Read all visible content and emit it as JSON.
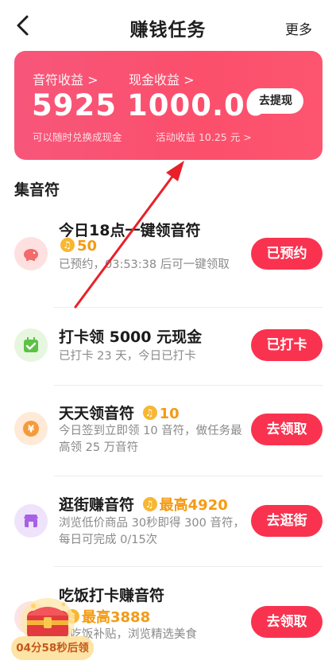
{
  "header": {
    "title": "赚钱任务",
    "more_label": "更多"
  },
  "earnings": {
    "notes_label": "音符收益 >",
    "notes_value": "5925",
    "notes_hint": "可以随时兑换成现金",
    "cash_label": "现金收益 >",
    "cash_value": "1000.00",
    "activity_hint": "活动收益 10.25 元 >",
    "withdraw_label": "去提现",
    "card_color": "#fb4f6c"
  },
  "section": {
    "title": "集音符"
  },
  "tasks": [
    {
      "icon": "piggy-bank-icon",
      "title": "今日18点一键领音符",
      "reward": "50",
      "desc": "已预约，03:53:38 后可一键领取",
      "button": "已预约"
    },
    {
      "icon": "calendar-check-icon",
      "title": "打卡领 5000 元现金",
      "reward": "",
      "desc": "已打卡 23 天，今日已打卡",
      "button": "已打卡"
    },
    {
      "icon": "yuan-coin-icon",
      "title": "天天领音符",
      "reward": "10",
      "desc": "今日签到立即领 10 音符，做任务最高领 25 万音符",
      "button": "去领取"
    },
    {
      "icon": "shop-icon",
      "title": "逛街赚音符",
      "reward": "最高4920",
      "desc": "浏览低价商品 30秒即得 300 音符，每日可完成 0/15次",
      "button": "去逛街"
    },
    {
      "icon": "meal-icon",
      "title": "吃饭打卡赚音符",
      "reward": "最高3888",
      "desc": "领吃饭补贴，浏览精选美食",
      "button": "去领取"
    }
  ],
  "floating": {
    "timer": "04分58秒后领"
  },
  "colors": {
    "accent": "#f9334f",
    "reward": "#f59a12",
    "arrow": "#e8202a"
  }
}
